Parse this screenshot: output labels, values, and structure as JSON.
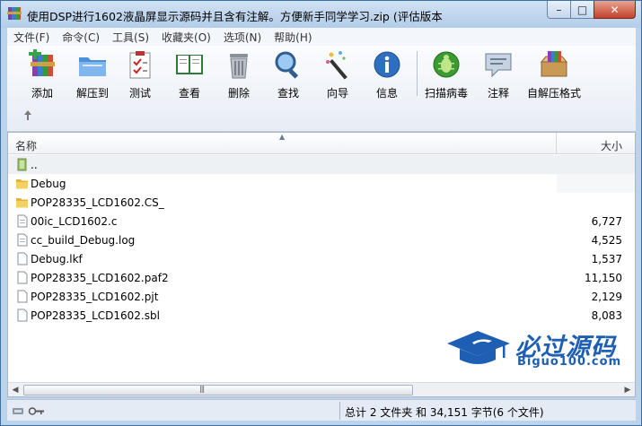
{
  "window": {
    "title": "使用DSP进行1602液晶屏显示源码并且含有注解。方便新手同学学习.zip (评估版本"
  },
  "window_controls": {
    "minimize": "–",
    "maximize": "□",
    "close": "✕"
  },
  "menu": [
    "文件(F)",
    "命令(C)",
    "工具(S)",
    "收藏夹(O)",
    "选项(N)",
    "帮助(H)"
  ],
  "toolbar": {
    "buttons": [
      {
        "label": "添加",
        "icon": "add-archive-icon"
      },
      {
        "label": "解压到",
        "icon": "extract-folder-icon"
      },
      {
        "label": "测试",
        "icon": "test-checklist-icon"
      },
      {
        "label": "查看",
        "icon": "view-book-icon"
      },
      {
        "label": "删除",
        "icon": "trash-icon"
      },
      {
        "label": "查找",
        "icon": "find-magnifier-icon"
      },
      {
        "label": "向导",
        "icon": "wizard-wand-icon"
      },
      {
        "label": "信息",
        "icon": "info-icon"
      },
      {
        "label": "扫描病毒",
        "icon": "virus-scan-icon"
      },
      {
        "label": "注释",
        "icon": "comment-icon"
      },
      {
        "label": "自解压格式",
        "icon": "sfx-box-icon"
      }
    ]
  },
  "filelist": {
    "col_name": "名称",
    "col_size": "大小",
    "rows": [
      {
        "name": "..",
        "size": "",
        "type": "parent"
      },
      {
        "name": "Debug",
        "size": "",
        "type": "folder"
      },
      {
        "name": "POP28335_LCD1602.CS_",
        "size": "",
        "type": "folder"
      },
      {
        "name": "00ic_LCD1602.c",
        "size": "6,727",
        "type": "file"
      },
      {
        "name": "cc_build_Debug.log",
        "size": "4,525",
        "type": "file"
      },
      {
        "name": "Debug.lkf",
        "size": "1,537",
        "type": "file"
      },
      {
        "name": "POP28335_LCD1602.paf2",
        "size": "11,150",
        "type": "file"
      },
      {
        "name": "POP28335_LCD1602.pjt",
        "size": "2,129",
        "type": "file"
      },
      {
        "name": "POP28335_LCD1602.sbl",
        "size": "8,083",
        "type": "file"
      }
    ]
  },
  "status": {
    "summary": "总计 2 文件夹 和 34,151 字节(6 个文件)"
  },
  "watermark": {
    "cn": "必过源码",
    "en": "Biguo100.com"
  },
  "colors": {
    "titlebar": "#bcd3ec",
    "watermark": "#1e5fb3",
    "close": "#c2402a"
  }
}
